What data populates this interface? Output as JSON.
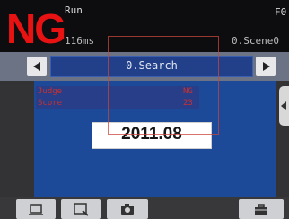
{
  "status": {
    "judgement": "NG",
    "mode": "Run",
    "mode_suffix": "F0",
    "time": "116ms",
    "scene": "0.Scene0"
  },
  "navigation": {
    "item_label": "0.Search",
    "prev_icon": "left-arrow-icon",
    "next_icon": "right-arrow-icon"
  },
  "result": {
    "rows": [
      {
        "label": "Judge",
        "value": "NG"
      },
      {
        "label": "Score",
        "value": "23"
      }
    ],
    "read_value": "2011.08"
  },
  "side_panel": {
    "icon": "collapse-left-icon"
  },
  "toolbar": {
    "buttons": [
      {
        "icon": "display-icon"
      },
      {
        "icon": "zoom-icon"
      },
      {
        "icon": "camera-icon"
      },
      {
        "icon": "toolbox-icon"
      }
    ]
  },
  "colors": {
    "ng": "#e81212",
    "image_area": "#1d4a98",
    "item_box": "#22408a",
    "band": "#6b7384"
  }
}
